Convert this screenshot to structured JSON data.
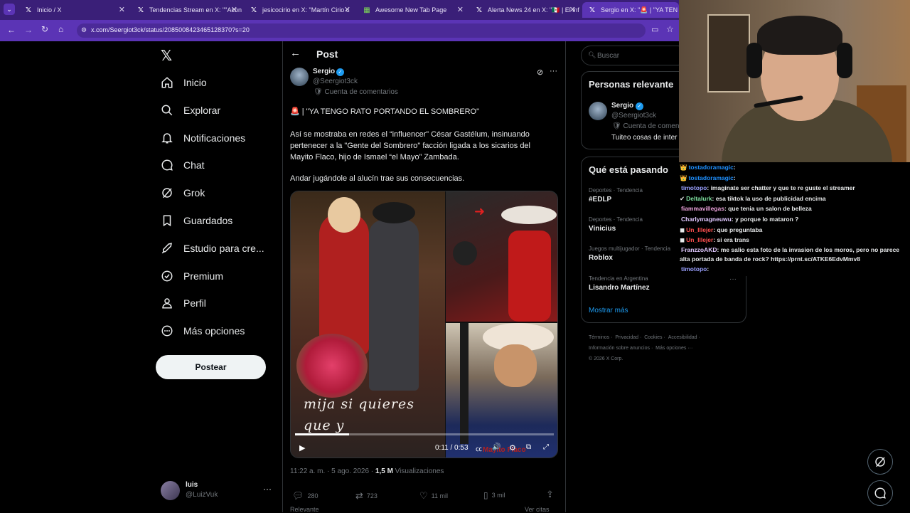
{
  "browser": {
    "tabs": [
      {
        "title": "Inicio / X",
        "icon": "x-logo-icon"
      },
      {
        "title": "Tendencias Stream en X: \"\"Acon",
        "icon": "x-logo-icon"
      },
      {
        "title": "jesicocirio en X: \"Martín Cirio c",
        "icon": "x-logo-icon"
      },
      {
        "title": "Awesome New Tab Page",
        "icon": "grid-icon"
      },
      {
        "title": "Alerta News 24 en X: \"🇲🇽 | El inf",
        "icon": "x-logo-icon"
      },
      {
        "title": "Sergio en X: \"🚨 | \"YA TEN",
        "icon": "x-logo-icon"
      }
    ],
    "url": "x.com/Seergiot3ck/status/2085008423465128370?s=20"
  },
  "nav": {
    "items": [
      {
        "label": "Inicio",
        "icon": "home-icon"
      },
      {
        "label": "Explorar",
        "icon": "search-icon"
      },
      {
        "label": "Notificaciones",
        "icon": "bell-icon"
      },
      {
        "label": "Chat",
        "icon": "chat-icon"
      },
      {
        "label": "Grok",
        "icon": "grok-icon"
      },
      {
        "label": "Guardados",
        "icon": "bookmark-icon"
      },
      {
        "label": "Estudio para cre...",
        "icon": "rocket-icon"
      },
      {
        "label": "Premium",
        "icon": "verified-icon"
      },
      {
        "label": "Perfil",
        "icon": "person-icon"
      },
      {
        "label": "Más opciones",
        "icon": "more-circle-icon"
      }
    ],
    "post_button": "Postear",
    "account": {
      "name": "luis",
      "handle": "@LuizVuk"
    }
  },
  "post": {
    "header": "Post",
    "author_name": "Sergio",
    "author_handle": "@Seergiot3ck",
    "account_label": "Cuenta de comentarios",
    "headline": "🚨 | \"YA TENGO RATO PORTANDO EL SOMBRERO\"",
    "paragraph1": "Así se mostraba en redes el “influencer” César Gastélum, insinuando pertenecer a la \"Gente del Sombrero\" facción ligada a los sicarios del Mayito Flaco, hijo de Ismael “el Mayo” Zambada.",
    "paragraph2": "Andar jugándole al alucín trae sus consecuencias.",
    "video": {
      "overlay_text_1": "mija si quieres",
      "overlay_text_2": "que y",
      "time": "0:11 / 0:53",
      "watermark": "Mayito Flaco",
      "progress": 0.21
    },
    "timestamp": "11:22 a. m. · 5 ago. 2026 · ",
    "views_count": "1,5 M",
    "views_label": " Visualizaciones",
    "stats": {
      "replies": "280",
      "reposts": "723",
      "likes": "11 mil",
      "bookmarks": "3 mil"
    },
    "footer_left": "Relevante",
    "footer_right": "Ver citas"
  },
  "right": {
    "search_placeholder": "Buscar",
    "relevant": {
      "title": "Personas relevante",
      "name": "Sergio",
      "handle": "@Seergiot3ck",
      "account_label": "Cuenta de comen",
      "bio": "Tuiteo cosas de inter"
    },
    "trends": {
      "title": "Qué está pasando",
      "items": [
        {
          "category": "Deportes · Tendencia",
          "name": "#EDLP"
        },
        {
          "category": "Deportes · Tendencia",
          "name": "Vinicius"
        },
        {
          "category": "Juegos multijugador · Tendencia",
          "name": "Roblox"
        },
        {
          "category": "Tendencia en Argentina",
          "name": "Lisandro Martínez"
        }
      ],
      "show_more": "Mostrar más"
    },
    "footer": {
      "line1": [
        "Términos",
        "Privacidad",
        "Cookies",
        "Accesibilidad"
      ],
      "line2": [
        "Información sobre anuncios",
        "Más opciones ···"
      ],
      "copyright": "© 2026 X Corp."
    }
  },
  "chat": {
    "messages": [
      {
        "user": "tostadoramagic",
        "text": "",
        "color": "#1e90ff",
        "badge": "👑"
      },
      {
        "user": "tostadoramagic",
        "text": "",
        "color": "#1e90ff",
        "badge": "👑"
      },
      {
        "user": "timotopo",
        "text": "imaginate ser chatter y que te re guste el streamer",
        "color": "#9aa0ff",
        "badge": ""
      },
      {
        "user": "Deltalurk",
        "text": "esa tiktok la uso de publicidad encima",
        "color": "#7fe0a0",
        "badge": "✔"
      },
      {
        "user": "fiammavillegas",
        "text": "que tenia un salon de belleza",
        "color": "#e8a0d8",
        "badge": ""
      },
      {
        "user": "Charlymagneuwu",
        "text": "y porque lo mataron ?",
        "color": "#e0c8ff",
        "badge": ""
      },
      {
        "user": "Un_lllejer",
        "text": " que preguntaba",
        "color": "#ff5050",
        "badge": "◼"
      },
      {
        "user": "Un_lllejer",
        "text": "si era trans",
        "color": "#ff5050",
        "badge": "◼"
      },
      {
        "user": "FranzzoAKD",
        "text": "me salio esta foto de la invasion de los moros, pero no parece alta portada de banda de rock? https://prnt.sc/ATKE6EdvMmv8",
        "color": "#e0c8ff",
        "badge": ""
      },
      {
        "user": "timotopo",
        "text": "",
        "color": "#9aa0ff",
        "badge": ""
      }
    ]
  },
  "colors": {
    "accent": "#1d9bf0",
    "browser": "#5b34b5"
  }
}
